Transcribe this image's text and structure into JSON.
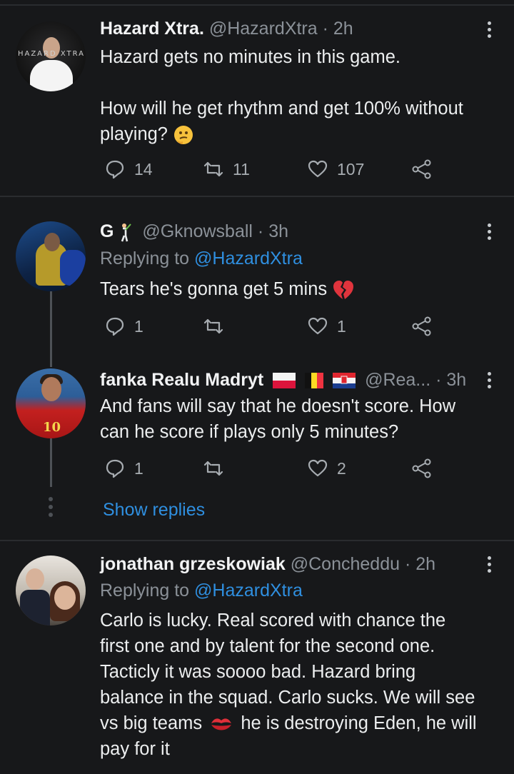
{
  "tweets": [
    {
      "display_name": "Hazard Xtra.",
      "handle": "@HazardXtra",
      "time": "· 2h",
      "avatar_logo_text": "HAZARD XTRA",
      "body_line1": "Hazard gets no minutes in this game.",
      "body_line2": "How will he get rhythm and get 100% without",
      "body_line3": "playing?",
      "replies": "14",
      "retweets": "11",
      "likes": "107"
    },
    {
      "display_name": "G",
      "handle": "@Gknowsball",
      "time": "· 3h",
      "replying_prefix": "Replying to ",
      "replying_to": "@HazardXtra",
      "body": "Tears he's gonna get 5 mins",
      "replies": "1",
      "retweets": "",
      "likes": "1"
    },
    {
      "display_name": "fanka Realu Madryt",
      "handle": "@Rea...",
      "time": "· 3h",
      "body_line1": "And fans will say that he doesn't score. How",
      "body_line2": "can he score if plays only 5 minutes?",
      "replies": "1",
      "retweets": "",
      "likes": "2",
      "avatar_number": "10"
    },
    {
      "display_name": "jonathan grzeskowiak",
      "handle": "@Concheddu",
      "time": "· 2h",
      "replying_prefix": "Replying to ",
      "replying_to": "@HazardXtra",
      "body_line1": "Carlo is lucky. Real scored with chance the",
      "body_line2": "first one and by talent for the second one.",
      "body_line3": "Tacticly it was soooo bad. Hazard bring",
      "body_line4": "balance in the squad. Carlo sucks. We will see",
      "body_line5a": "vs big teams",
      "body_line5b": "he is destroying Eden, he will",
      "body_line6": "pay for it"
    }
  ],
  "show_replies_label": "Show replies",
  "colors": {
    "background": "#17181a",
    "accent": "#2f8fe0",
    "muted": "#8b9198",
    "text": "#eceeef"
  },
  "icons": [
    "reply-icon",
    "retweet-icon",
    "like-icon",
    "share-icon",
    "more-options-icon",
    "thinking-face-emoji",
    "broken-heart-emoji",
    "kiss-mark-emoji",
    "golfer-emoji",
    "poland-flag",
    "belgium-flag",
    "croatia-flag"
  ]
}
